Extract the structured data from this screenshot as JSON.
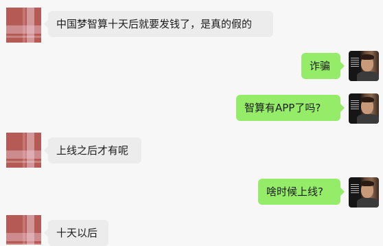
{
  "colors": {
    "background": "#f7f7f7",
    "incoming_bubble": "#ececec",
    "outgoing_bubble": "#95ec69",
    "text": "#1b1b1b"
  },
  "messages": [
    {
      "side": "left",
      "text": "中国梦智算十天后就要发钱了，是真的假的",
      "avatar": "plaid-avatar"
    },
    {
      "side": "right",
      "text": "诈骗",
      "avatar": "photo-avatar"
    },
    {
      "side": "right",
      "text": "智算有APP了吗?",
      "avatar": "photo-avatar"
    },
    {
      "side": "left",
      "text": "上线之后才有呢",
      "avatar": "plaid-avatar"
    },
    {
      "side": "right",
      "text": "啥时候上线?",
      "avatar": "photo-avatar"
    },
    {
      "side": "left",
      "text": "十天以后",
      "avatar": "plaid-avatar"
    }
  ]
}
